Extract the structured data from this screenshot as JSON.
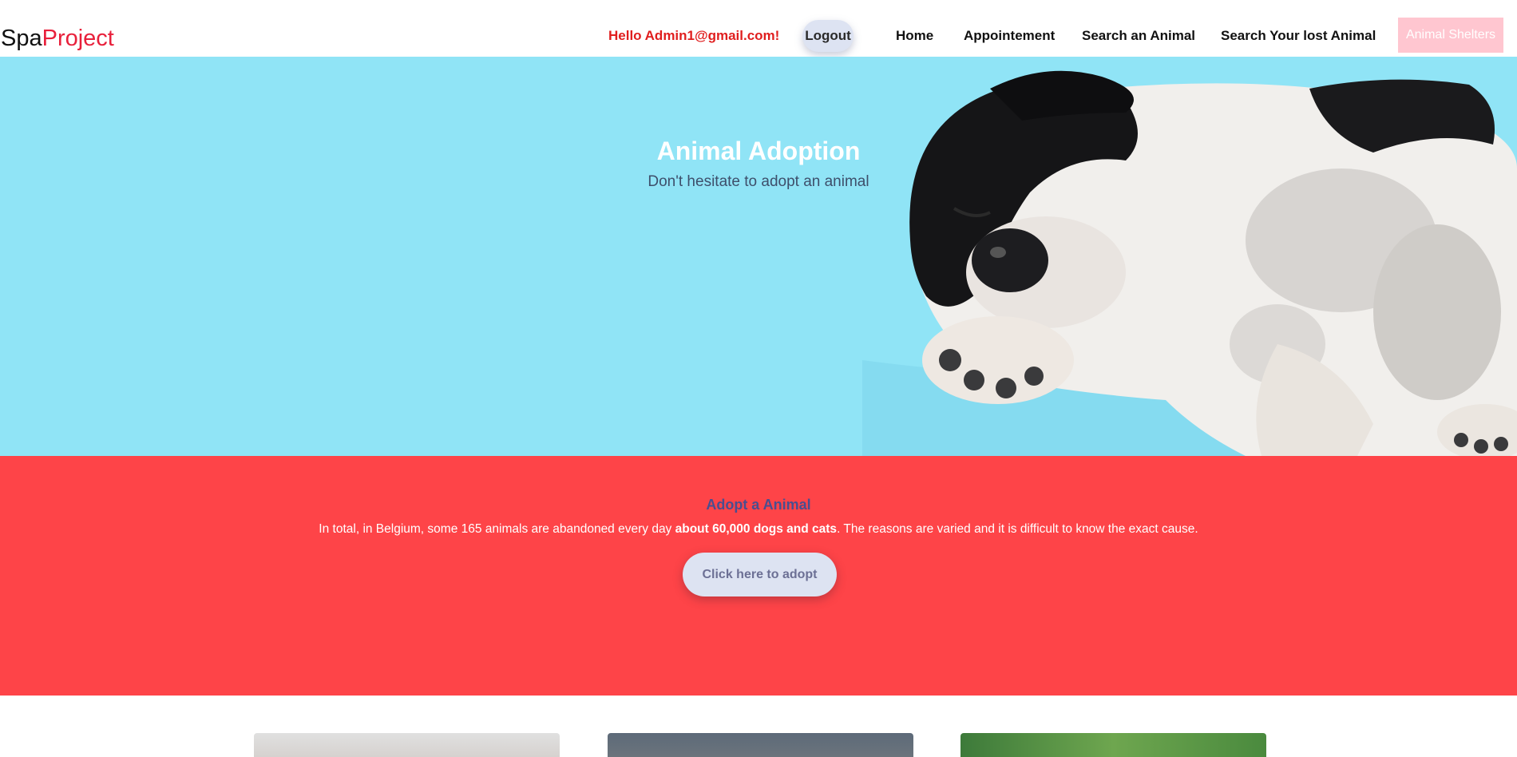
{
  "navbar": {
    "brand_part1": "Spa",
    "brand_part2": "Project",
    "greeting": "Hello Admin1@gmail.com!",
    "logout_label": "Logout",
    "links": [
      "Home",
      "Appointement",
      "Search an Animal",
      "Search Your lost Animal"
    ],
    "shelters_label": "Animal Shelters"
  },
  "hero": {
    "title": "Animal Adoption",
    "subtitle": "Don't hesitate to adopt an animal",
    "background": "#90e4f6"
  },
  "adopt": {
    "title": "Adopt a Animal",
    "text_before": "In total, in Belgium, some 165 animals are abandoned every day ",
    "text_bold": "about 60,000 dogs and cats",
    "text_after": ". The reasons are varied and it is difficult to know the exact cause.",
    "button_label": "Click here to adopt",
    "background": "#fe4448"
  },
  "colors": {
    "brand_accent": "#e8203b",
    "greeting": "#e01e1e",
    "button_bg": "#dde3f2",
    "shelters_bg": "#ffc6d0"
  }
}
